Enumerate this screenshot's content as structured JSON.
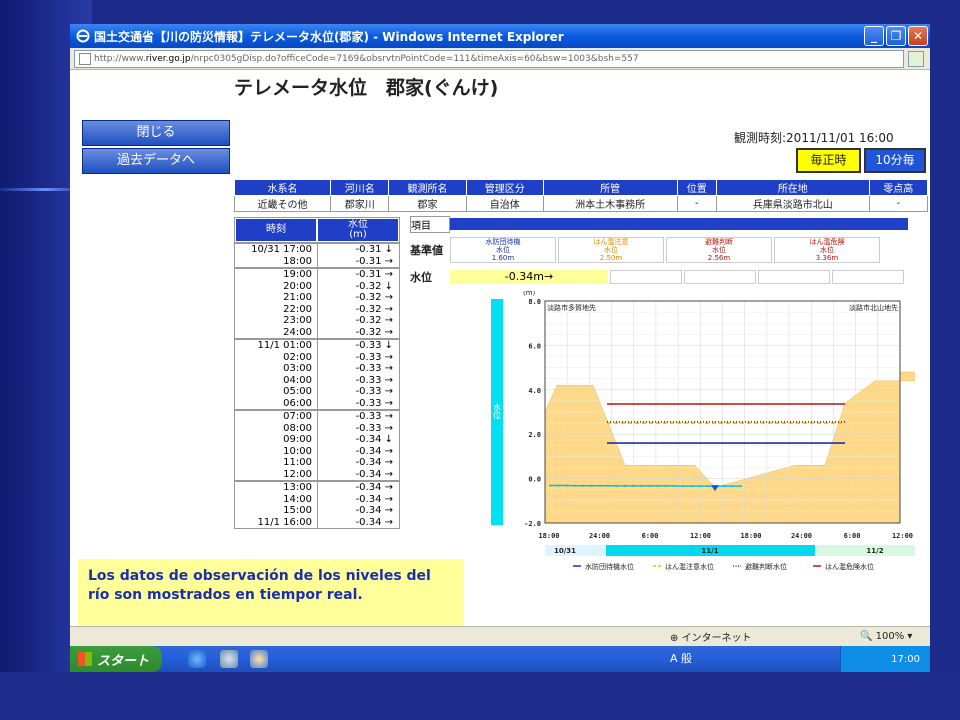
{
  "window": {
    "title": "国土交通省【川の防災情報】テレメータ水位(郡家) - Windows Internet Explorer",
    "url_prefix": "http://www.",
    "url_domain": "river.go.jp",
    "url_rest": "/nrpc0305gDisp.do?officeCode=7169&obsrvtnPointCode=111&timeAxis=60&bsw=1003&bsh=557"
  },
  "nav": {
    "close_label": "閉じる",
    "past_label": "過去データへ"
  },
  "page": {
    "title": "テレメータ水位　郡家(ぐんけ)",
    "obs_time": "観測時刻:2011/11/01 16:00",
    "btn_seiji": "毎正時",
    "btn_10min": "10分毎"
  },
  "info": {
    "headers": [
      "水系名",
      "河川名",
      "観測所名",
      "管理区分",
      "所管",
      "位置",
      "所在地",
      "零点高"
    ],
    "values": [
      "近畿その他",
      "郡家川",
      "郡家",
      "自治体",
      "洲本土木事務所",
      "-",
      "兵庫県淡路市北山",
      "-"
    ]
  },
  "timetable": {
    "col_time": "時刻",
    "col_level": "水位",
    "col_unit": "(m)",
    "groups": [
      [
        [
          "10/31 17:00",
          "-0.31 ↓"
        ],
        [
          "18:00",
          "-0.31 →"
        ]
      ],
      [
        [
          "19:00",
          "-0.31 →"
        ],
        [
          "20:00",
          "-0.32 ↓"
        ],
        [
          "21:00",
          "-0.32 →"
        ],
        [
          "22:00",
          "-0.32 →"
        ],
        [
          "23:00",
          "-0.32 →"
        ],
        [
          "24:00",
          "-0.32 →"
        ]
      ],
      [
        [
          "11/1 01:00",
          "-0.33 ↓"
        ],
        [
          "02:00",
          "-0.33 →"
        ],
        [
          "03:00",
          "-0.33 →"
        ],
        [
          "04:00",
          "-0.33 →"
        ],
        [
          "05:00",
          "-0.33 →"
        ],
        [
          "06:00",
          "-0.33 →"
        ]
      ],
      [
        [
          "07:00",
          "-0.33 →"
        ],
        [
          "08:00",
          "-0.33 →"
        ],
        [
          "09:00",
          "-0.34 ↓"
        ],
        [
          "10:00",
          "-0.34 →"
        ],
        [
          "11:00",
          "-0.34 →"
        ],
        [
          "12:00",
          "-0.34 →"
        ]
      ],
      [
        [
          "13:00",
          "-0.34 →"
        ],
        [
          "14:00",
          "-0.34 →"
        ],
        [
          "15:00",
          "-0.34 →"
        ],
        [
          "11/1 16:00",
          "-0.34 →"
        ]
      ]
    ]
  },
  "standard": {
    "item_label": "項目",
    "std_label": "基準値",
    "level_label": "水位",
    "current": "-0.34m→",
    "levels": [
      {
        "name1": "水防団待機",
        "name2": "水位",
        "value": "1.60m",
        "color": "#1a2fb0"
      },
      {
        "name1": "はん濫注意",
        "name2": "水位",
        "value": "2.50m",
        "color": "#e08a00"
      },
      {
        "name1": "避難判断",
        "name2": "水位",
        "value": "2.56m",
        "color": "#c01010"
      },
      {
        "name1": "はん濫危険",
        "name2": "水位",
        "value": "3.36m",
        "color": "#c01010"
      }
    ]
  },
  "chart_data": {
    "type": "line",
    "unit_label": "(m)",
    "side_label": "水位",
    "left_bank": "淡路市多賀地先",
    "right_bank": "淡路市北山地先",
    "ylim": [
      -2.0,
      8.0
    ],
    "yticks": [
      "8.0",
      "6.0",
      "4.0",
      "2.0",
      "0.0",
      "-2.0"
    ],
    "xticks": [
      "18:00",
      "24:00",
      "6:00",
      "12:00",
      "18:00",
      "24:00",
      "6:00",
      "12:00"
    ],
    "dates": [
      "10/31",
      "11/1",
      "11/2"
    ],
    "thresholds": [
      {
        "name": "水防団待機水位",
        "value": 1.6,
        "color": "#1a2fb0",
        "style": "solid"
      },
      {
        "name": "はん濫注意水位",
        "value": 2.5,
        "color": "#e8c000",
        "style": "dashed"
      },
      {
        "name": "避難判断水位",
        "value": 2.56,
        "color": "#c01010",
        "style": "dotted"
      },
      {
        "name": "はん濫危険水位",
        "value": 3.36,
        "color": "#c01010",
        "style": "solid"
      }
    ],
    "series": [
      {
        "name": "水位",
        "values": [
          -0.31,
          -0.31,
          -0.31,
          -0.32,
          -0.32,
          -0.32,
          -0.32,
          -0.32,
          -0.33,
          -0.33,
          -0.33,
          -0.33,
          -0.33,
          -0.33,
          -0.33,
          -0.33,
          -0.34,
          -0.34,
          -0.34,
          -0.34,
          -0.34,
          -0.34,
          -0.34,
          -0.34
        ]
      }
    ]
  },
  "note": "Los datos de observación de los niveles del río son mostrados en tiempor real.",
  "status": {
    "zone": "インターネット",
    "zoom": "100%"
  },
  "taskbar": {
    "start": "スタート",
    "ime": "A 般",
    "clock": "17:00"
  }
}
